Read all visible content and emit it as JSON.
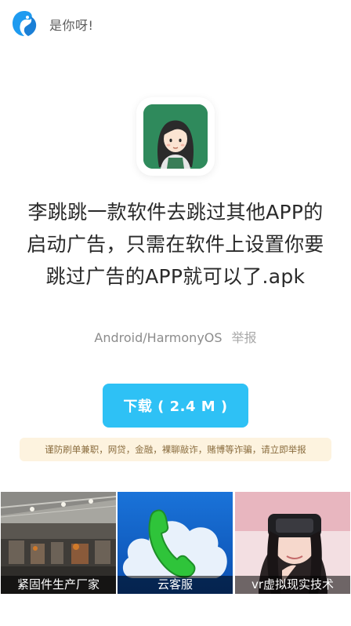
{
  "header": {
    "title": "是你呀!"
  },
  "app": {
    "title": "李跳跳一款软件去跳过其他APP的启动广告，只需在软件上设置你要跳过广告的APP就可以了.apk",
    "platform": "Android/HarmonyOS",
    "report_label": "举报"
  },
  "download": {
    "label": "下载 ( 2.4 M )"
  },
  "notice": {
    "text": "谨防刷单兼职，网贷，金融，裸聊敲诈，赌博等诈骗，请立即举报"
  },
  "ads": [
    {
      "caption": "紧固件生产厂家"
    },
    {
      "caption": "云客服"
    },
    {
      "caption": "vr虚拟现实技术"
    }
  ],
  "colors": {
    "accent": "#2ec1f5",
    "notice_bg": "#fdf3df",
    "notice_text": "#8a6d3f",
    "app_icon_bg": "#2f8a5c"
  }
}
